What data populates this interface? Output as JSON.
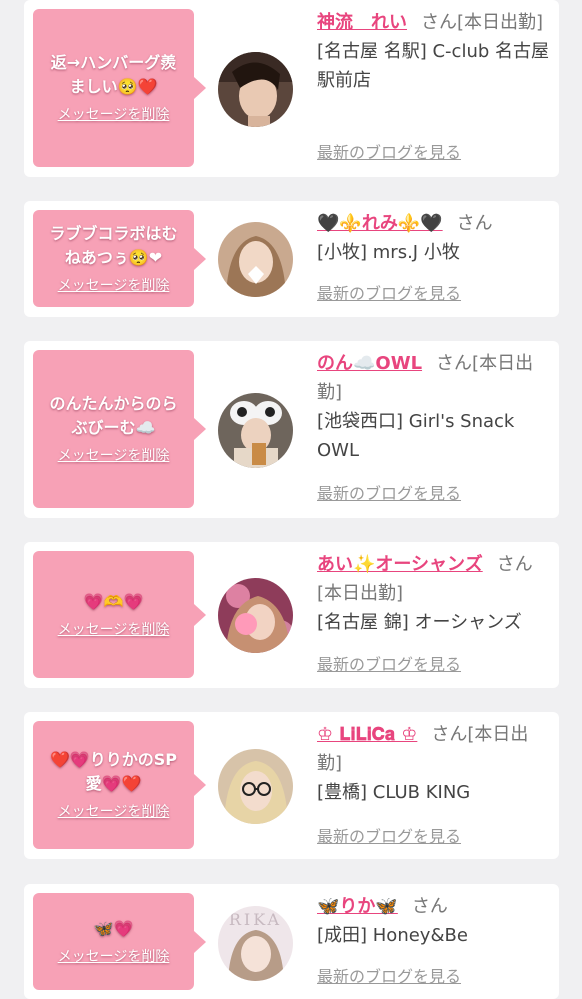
{
  "entries": [
    {
      "message": "返→ハンバーグ羨\nましい🥺❤️",
      "delete_label": "メッセージを削除",
      "name": "神流　れい",
      "san": "さん",
      "status": "[本日出勤]",
      "shop": "[名古屋 名駅] C-club 名古屋駅前店",
      "blog_label": "最新のブログを見る"
    },
    {
      "message": "ラブブコラボはむ\nねあつぅ🥺❤",
      "delete_label": "メッセージを削除",
      "name": "🖤⚜️れみ⚜️🖤",
      "san": "さん",
      "status": "",
      "shop": "[小牧] mrs.J 小牧",
      "blog_label": "最新のブログを見る"
    },
    {
      "message": "のんたんからのら\nぶびーむ☁️",
      "delete_label": "メッセージを削除",
      "name": "のん☁️OWL",
      "san": "さん",
      "status": "[本日出勤]",
      "shop": "[池袋西口] Girl's Snack OWL",
      "blog_label": "最新のブログを見る"
    },
    {
      "message": "💗🫶💗",
      "delete_label": "メッセージを削除",
      "name": "あい✨オーシャンズ",
      "san": "さん",
      "status": "[本日出勤]",
      "shop": "[名古屋 錦] オーシャンズ",
      "blog_label": "最新のブログを見る"
    },
    {
      "message": "❤️💗りりかのSP\n愛💗❤️",
      "delete_label": "メッセージを削除",
      "name": "♔ 𝐋𝐢𝐋𝐢𝐂𝐚 ♔",
      "san": "さん",
      "status": "[本日出勤]",
      "shop": "[豊橋] CLUB KING",
      "blog_label": "最新のブログを見る"
    },
    {
      "message": "🦋💗",
      "delete_label": "メッセージを削除",
      "name": "🦋りか🦋",
      "san": "さん",
      "status": "",
      "shop": "[成田] Honey&Be",
      "blog_label": "最新のブログを見る"
    }
  ],
  "avatar_text": "RIKA",
  "colors": {
    "background": "#f0f0f2",
    "card": "#ffffff",
    "bubble": "#f7a1b6",
    "name": "#e8457e",
    "muted": "#999999"
  }
}
